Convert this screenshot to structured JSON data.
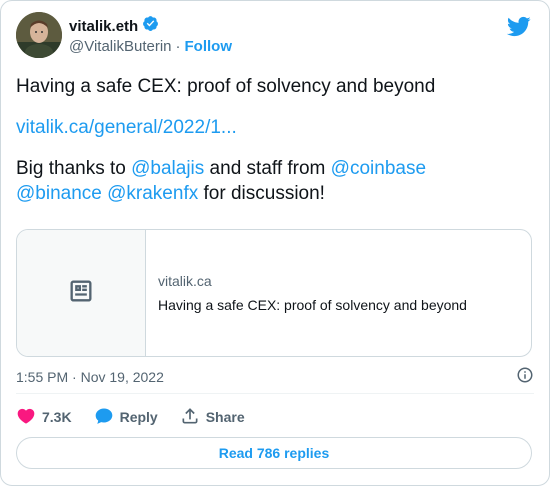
{
  "author": {
    "name": "vitalik.eth",
    "handle": "@VitalikButerin",
    "separator": "·",
    "follow_label": "Follow"
  },
  "tweet": {
    "line1": "Having a safe CEX: proof of solvency and beyond",
    "url_text": "vitalik.ca/general/2022/1...",
    "thanks_prefix": "Big thanks to ",
    "mention_1": "@balajis",
    "thanks_middle": " and staff from ",
    "mention_2": "@coinbase",
    "mention_3": "@binance",
    "mention_4": "@krakenfx",
    "thanks_suffix": " for discussion!"
  },
  "link_preview": {
    "icon": "article-icon",
    "domain": "vitalik.ca",
    "title": "Having a safe CEX: proof of solvency and beyond"
  },
  "meta": {
    "timestamp": "1:55 PM · Nov 19, 2022",
    "info_icon": "info-icon"
  },
  "actions": {
    "likes": "7.3K",
    "reply_label": "Reply",
    "share_label": "Share"
  },
  "read_replies_label": "Read 786 replies",
  "colors": {
    "accent": "#1d9bf0",
    "like": "#f91880",
    "text_primary": "#0f1419",
    "text_secondary": "#536471",
    "border": "#cfd9de"
  }
}
